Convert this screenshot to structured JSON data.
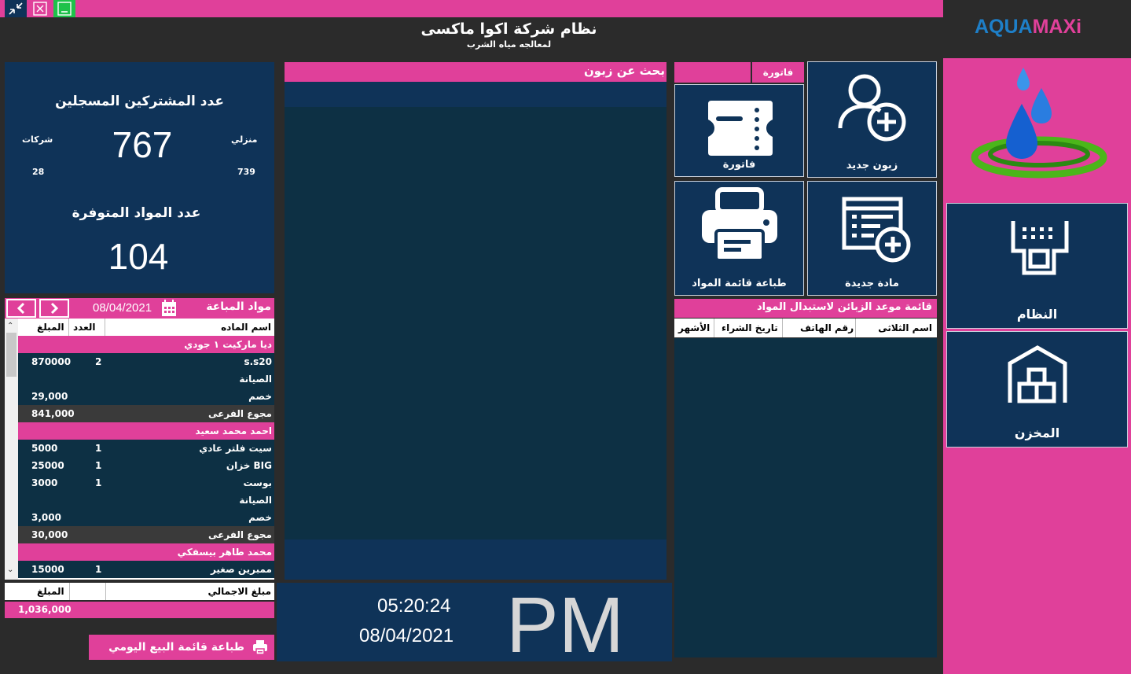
{
  "window": {
    "title": "نظام شركة اكوا ماكسى",
    "subtitle": "لمعالجه مياه الشرب",
    "logo_left": "AQUA",
    "logo_right": "MAXi"
  },
  "stats": {
    "subscribers_label": "عدد المشتركين المسجلين",
    "subscribers_total": "767",
    "companies_label": "شركات",
    "companies_count": "28",
    "home_label": "منزلي",
    "home_count": "739",
    "materials_label": "عدد المواد المتوفرة",
    "materials_total": "104"
  },
  "sold": {
    "title": "مواد المباعة",
    "date": "08/04/2021",
    "columns": {
      "name": "اسم الماده",
      "qty": "العدد",
      "amount": "المبلغ"
    },
    "rows": [
      {
        "kind": "group",
        "name": "ديا ماركيت ١ جودي",
        "qty": "",
        "amount": ""
      },
      {
        "kind": "item",
        "name": "s.s20",
        "qty": "2",
        "amount": "870000"
      },
      {
        "kind": "item",
        "name": "الصيانة",
        "qty": "",
        "amount": ""
      },
      {
        "kind": "item",
        "name": "خصم",
        "qty": "",
        "amount": "29,000"
      },
      {
        "kind": "sub",
        "name": "مجوع الفرعى",
        "qty": "",
        "amount": "841,000"
      },
      {
        "kind": "group",
        "name": "احمد محمد سعيد",
        "qty": "",
        "amount": ""
      },
      {
        "kind": "item",
        "name": "سيت فلتر عادي",
        "qty": "1",
        "amount": "5000"
      },
      {
        "kind": "item",
        "name": "خزان BIG",
        "qty": "1",
        "amount": "25000"
      },
      {
        "kind": "item",
        "name": "بوست",
        "qty": "1",
        "amount": "3000"
      },
      {
        "kind": "item",
        "name": "الصيانة",
        "qty": "",
        "amount": ""
      },
      {
        "kind": "item",
        "name": "خصم",
        "qty": "",
        "amount": "3,000"
      },
      {
        "kind": "sub",
        "name": "مجوع الفرعى",
        "qty": "",
        "amount": "30,000"
      },
      {
        "kind": "group",
        "name": "محمد طاهر بيسفكي",
        "qty": "",
        "amount": ""
      },
      {
        "kind": "item",
        "name": "ممبرين صغير",
        "qty": "1",
        "amount": "15000"
      }
    ],
    "total_label": "مبلغ الاجمالي",
    "total_amount_label": "المبلغ",
    "total_value": "1,036,000",
    "print_daily": "طباعة قائمة البيع اليومي"
  },
  "search": {
    "label": "بحث عن زبون"
  },
  "clock": {
    "time": "05:20:24",
    "date": "08/04/2021",
    "ampm": "PM"
  },
  "tiles": {
    "invoice_tab": "فاتورة",
    "new_customer": "زبون جديد",
    "invoice": "فاتورة",
    "new_material": "مادة جديدة",
    "print_materials": "طباعة قائمة المواد"
  },
  "appointments": {
    "title": "قائمة موعد الزبائن لاستبدال المواد",
    "columns": [
      "اسم الثلاثى",
      "رقم الهاتف",
      "تاريخ الشراء",
      "الأشهر"
    ]
  },
  "nav": {
    "system": "النظام",
    "store": "المخزن"
  },
  "colors": {
    "pink": "#e0409a",
    "navy": "#0f3358",
    "dark": "#0d3044",
    "subrow": "#3a3a3a"
  }
}
